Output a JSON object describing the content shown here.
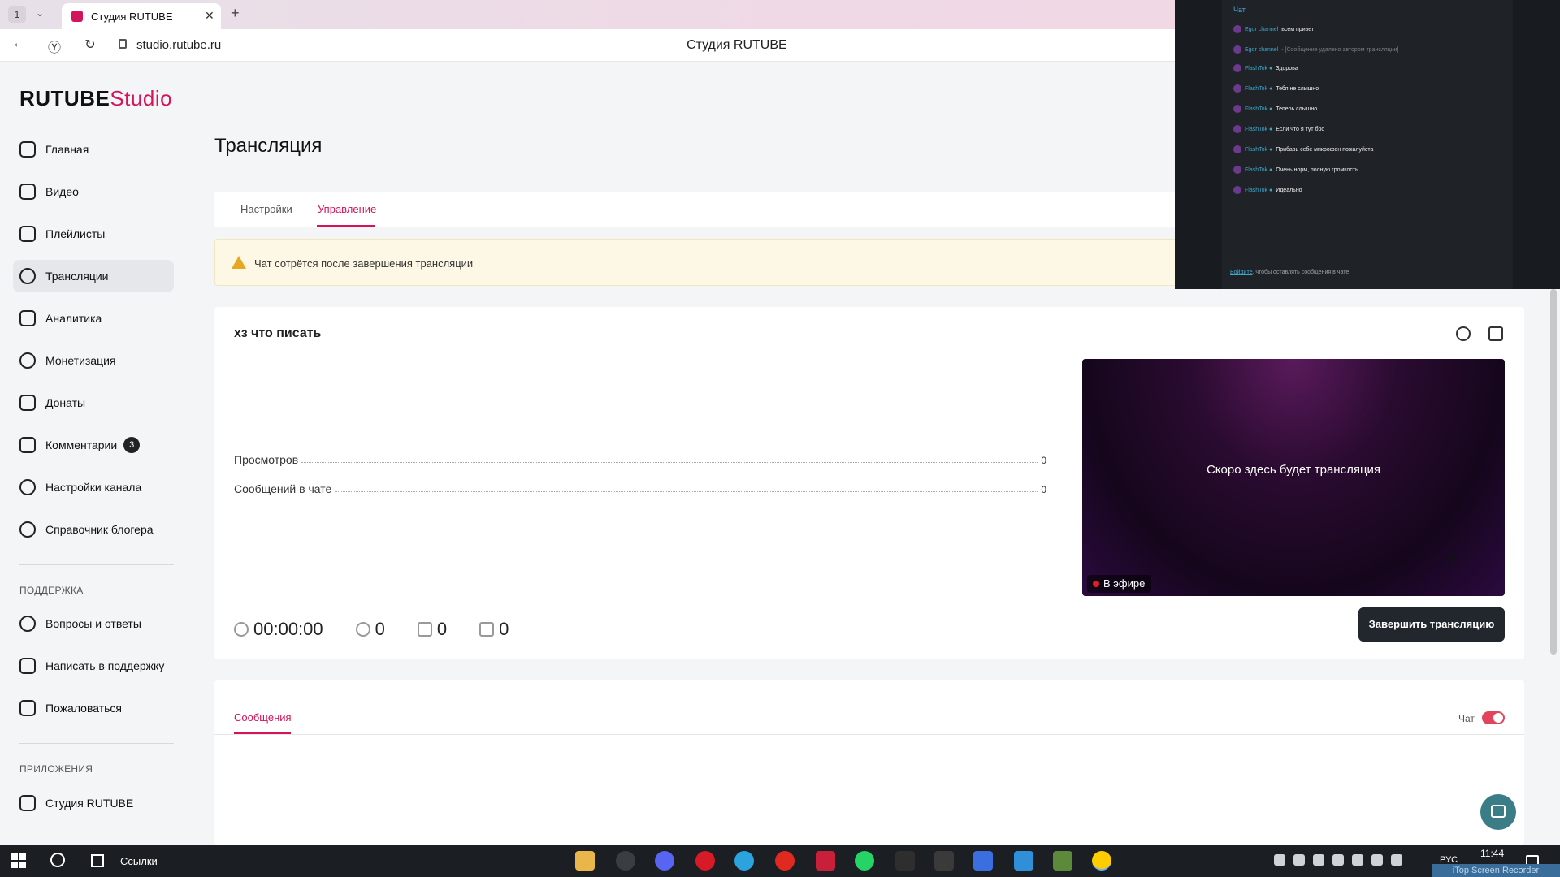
{
  "browser": {
    "tab_counter": "1",
    "tab_title": "Студия RUTUBE",
    "url": "studio.rutube.ru",
    "page_title": "Студия RUTUBE"
  },
  "sidebar": {
    "logo_main": "RUTUBE",
    "logo_suffix": "Studio",
    "items": [
      {
        "label": "Главная",
        "icon": "home-icon"
      },
      {
        "label": "Видео",
        "icon": "video-icon"
      },
      {
        "label": "Плейлисты",
        "icon": "playlist-icon"
      },
      {
        "label": "Трансляции",
        "icon": "broadcast-icon"
      },
      {
        "label": "Аналитика",
        "icon": "analytics-icon"
      },
      {
        "label": "Монетизация",
        "icon": "ruble-icon"
      },
      {
        "label": "Донаты",
        "icon": "wallet-icon"
      },
      {
        "label": "Комментарии",
        "icon": "comment-icon",
        "badge": "3"
      },
      {
        "label": "Настройки канала",
        "icon": "gear-icon"
      },
      {
        "label": "Справочник блогера",
        "icon": "info-icon"
      }
    ],
    "support_title": "ПОДДЕРЖКА",
    "support_items": [
      {
        "label": "Вопросы и ответы",
        "icon": "question-icon"
      },
      {
        "label": "Написать в поддержку",
        "icon": "mail-icon"
      },
      {
        "label": "Пожаловаться",
        "icon": "flag-icon"
      }
    ],
    "apps_title": "ПРИЛОЖЕНИЯ",
    "apps_items": [
      {
        "label": "Студия RUTUBE",
        "icon": "studio-icon"
      }
    ]
  },
  "main": {
    "title": "Трансляция",
    "tabs": [
      {
        "label": "Настройки"
      },
      {
        "label": "Управление"
      }
    ],
    "warning": "Чат сотрётся после завершения трансляции",
    "stream": {
      "name": "хз что писать",
      "stats": [
        {
          "label": "Просмотров",
          "value": "0"
        },
        {
          "label": "Сообщений в чате",
          "value": "0"
        }
      ],
      "preview_text": "Скоро здесь будет трансляция",
      "live_label": "В эфире",
      "end_button": "Завершить трансляцию",
      "timer": "00:00:00",
      "viewers": "0",
      "likes": "0",
      "dislikes": "0"
    },
    "messages": {
      "tab": "Сообщения",
      "chat_toggle_label": "Чат"
    }
  },
  "chat_overlay": {
    "title": "Чат",
    "messages": [
      {
        "user": "Egor channel",
        "text": "всем привет",
        "muted": false
      },
      {
        "user": "Egor channel",
        "text": "- [Сообщение удалено автором трансляции]",
        "muted": true
      },
      {
        "user": "FlashTok ●",
        "text": "Здорова",
        "muted": false
      },
      {
        "user": "FlashTok ●",
        "text": "Тебя не слышно",
        "muted": false
      },
      {
        "user": "FlashTok ●",
        "text": "Теперь слышно",
        "muted": false
      },
      {
        "user": "FlashTok ●",
        "text": "Если что я тут бро",
        "muted": false
      },
      {
        "user": "FlashTok ●",
        "text": "Прибавь себе микрофон пожалуйста",
        "muted": false
      },
      {
        "user": "FlashTok ●",
        "text": "Очень норм, полную громкость",
        "muted": false
      },
      {
        "user": "FlashTok ●",
        "text": "Идеально",
        "muted": false
      }
    ],
    "login_link": "Войдите",
    "login_text": ", чтобы оставлять сообщения в чате"
  },
  "taskbar": {
    "links_label": "Ссылки",
    "lang": "РУС",
    "time": "11:44",
    "recorder": "iTop Screen Recorder"
  },
  "colors": {
    "accent": "#d4145a",
    "dark_button": "#22272d",
    "warning_bg": "#fdf8e6"
  }
}
